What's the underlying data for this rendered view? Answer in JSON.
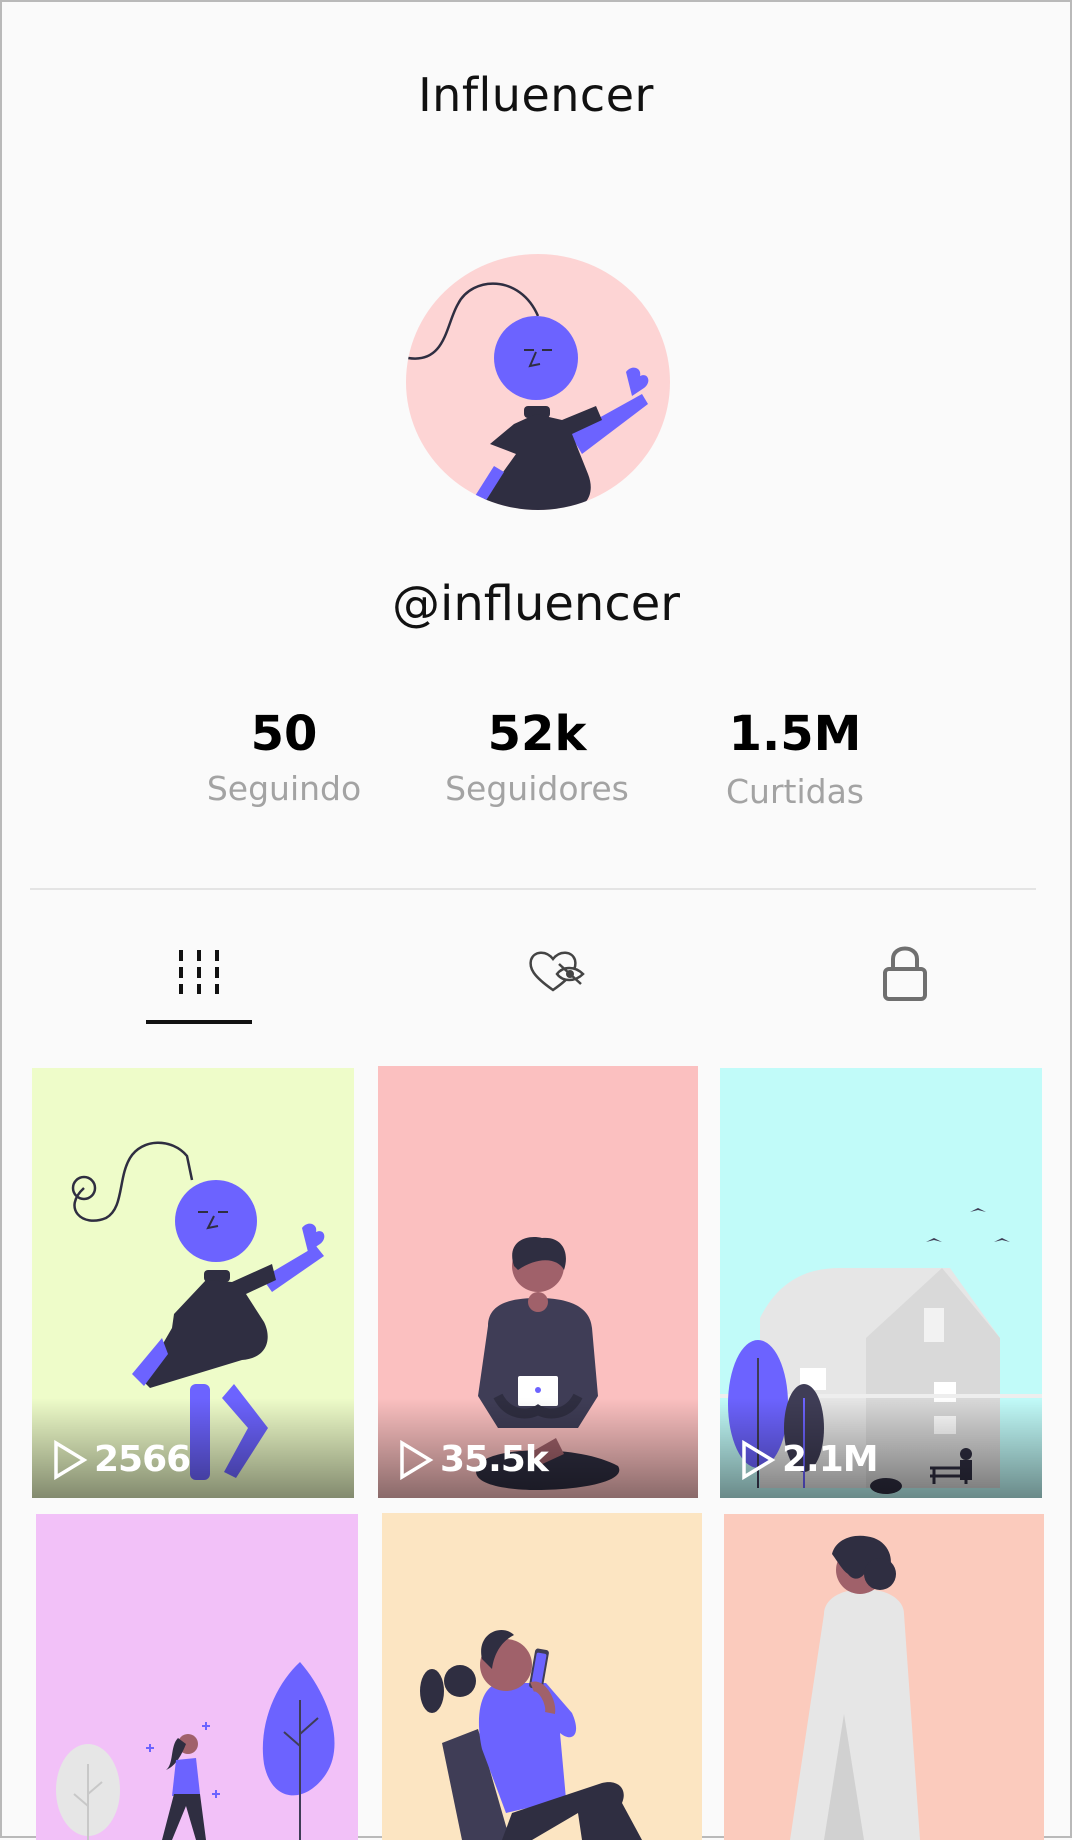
{
  "header": {
    "title": "Influencer"
  },
  "profile": {
    "handle": "@influencer",
    "avatar_bg": "#fdd4d4"
  },
  "stats": [
    {
      "value": "50",
      "label": "Seguindo"
    },
    {
      "value": "52k",
      "label": "Seguidores"
    },
    {
      "value": "1.5M",
      "label": "Curtidas"
    }
  ],
  "tabs": [
    {
      "icon": "grid-icon",
      "active": true
    },
    {
      "icon": "liked-hidden-icon",
      "active": false
    },
    {
      "icon": "lock-icon",
      "active": false
    }
  ],
  "videos": [
    {
      "views": "2566",
      "bg": "#eefcc9",
      "illustration": "dancing-woman"
    },
    {
      "views": "35.5k",
      "bg": "#fbc0c0",
      "illustration": "man-with-laptop"
    },
    {
      "views": "2.1M",
      "bg": "#c1fbf9",
      "illustration": "house-and-trees"
    },
    {
      "views": "",
      "bg": "#f2c1f8",
      "illustration": "woman-walking-trees"
    },
    {
      "views": "",
      "bg": "#fce5c2",
      "illustration": "woman-with-phone"
    },
    {
      "views": "",
      "bg": "#fbcbbd",
      "illustration": "man-from-behind"
    }
  ],
  "colors": {
    "accent": "#6c63ff",
    "dark": "#2f2e41"
  }
}
